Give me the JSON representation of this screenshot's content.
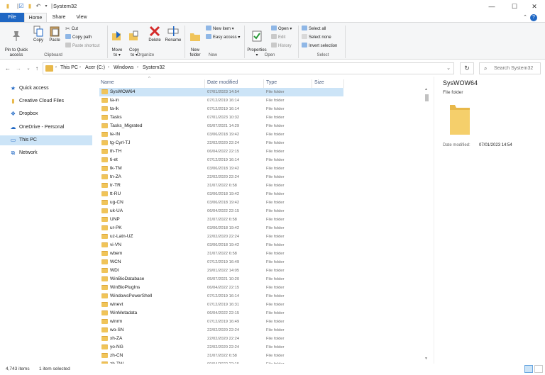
{
  "window": {
    "title": "System32",
    "controls": {
      "minimize": "—",
      "maximize": "☐",
      "close": "✕"
    }
  },
  "ribbon_tabs": [
    "File",
    "Home",
    "Share",
    "View"
  ],
  "ribbon": {
    "clipboard": {
      "label": "Clipboard",
      "pin": "Pin to Quick\naccess",
      "copy": "Copy",
      "paste": "Paste",
      "cut": "Cut",
      "copy_path": "Copy path",
      "paste_shortcut": "Paste shortcut"
    },
    "organize": {
      "label": "Organize",
      "move_to": "Move\nto ▾",
      "copy_to": "Copy\nto ▾",
      "delete": "Delete",
      "rename": "Rename"
    },
    "new": {
      "label": "New",
      "new_folder": "New\nfolder",
      "new_item": "New item ▾",
      "easy_access": "Easy access ▾"
    },
    "open": {
      "label": "Open",
      "properties": "Properties\n▾",
      "open": "Open ▾",
      "edit": "Edit",
      "history": "History"
    },
    "select": {
      "label": "Select",
      "select_all": "Select all",
      "select_none": "Select none",
      "invert": "Invert selection"
    }
  },
  "address": {
    "crumbs": [
      "This PC",
      "Acer (C:)",
      "Windows",
      "System32"
    ]
  },
  "search": {
    "placeholder": "Search System32"
  },
  "nav_pane": [
    {
      "label": "Quick access",
      "icon": "star-icon",
      "color": "#1f67c4"
    },
    {
      "label": "Creative Cloud Files",
      "icon": "creative-cloud-icon",
      "color": "#e8b84a"
    },
    {
      "label": "Dropbox",
      "icon": "dropbox-icon",
      "color": "#1f67c4"
    },
    {
      "label": "OneDrive - Personal",
      "icon": "onedrive-icon",
      "color": "#1f67c4"
    },
    {
      "label": "This PC",
      "icon": "computer-icon",
      "color": "#1f67c4",
      "selected": true
    },
    {
      "label": "Network",
      "icon": "network-icon",
      "color": "#1f67c4"
    }
  ],
  "columns": {
    "name": "Name",
    "date": "Date modified",
    "type": "Type",
    "size": "Size"
  },
  "files": [
    {
      "name": "SysWOW64",
      "date": "07/01/2023 14:54",
      "type": "File folder",
      "selected": true
    },
    {
      "name": "ta-in",
      "date": "07/12/2019 16:14",
      "type": "File folder"
    },
    {
      "name": "ta-lk",
      "date": "07/12/2019 16:14",
      "type": "File folder"
    },
    {
      "name": "Tasks",
      "date": "07/01/2023 10:32",
      "type": "File folder"
    },
    {
      "name": "Tasks_Migrated",
      "date": "05/07/2021 14:29",
      "type": "File folder"
    },
    {
      "name": "te-IN",
      "date": "03/06/2018 19:42",
      "type": "File folder"
    },
    {
      "name": "tg-Cyrl-TJ",
      "date": "22/02/2020 22:24",
      "type": "File folder"
    },
    {
      "name": "th-TH",
      "date": "06/04/2022 22:15",
      "type": "File folder"
    },
    {
      "name": "ti-et",
      "date": "07/12/2019 16:14",
      "type": "File folder"
    },
    {
      "name": "tk-TM",
      "date": "03/06/2018 19:42",
      "type": "File folder"
    },
    {
      "name": "tn-ZA",
      "date": "22/02/2020 22:24",
      "type": "File folder"
    },
    {
      "name": "tr-TR",
      "date": "31/07/2022 6:58",
      "type": "File folder"
    },
    {
      "name": "tt-RU",
      "date": "03/06/2018 19:42",
      "type": "File folder"
    },
    {
      "name": "ug-CN",
      "date": "03/06/2018 19:42",
      "type": "File folder"
    },
    {
      "name": "uk-UA",
      "date": "06/04/2022 22:15",
      "type": "File folder"
    },
    {
      "name": "UNP",
      "date": "31/07/2022 6:58",
      "type": "File folder"
    },
    {
      "name": "ur-PK",
      "date": "03/06/2018 19:42",
      "type": "File folder"
    },
    {
      "name": "uz-Latn-UZ",
      "date": "22/02/2020 22:24",
      "type": "File folder"
    },
    {
      "name": "vi-VN",
      "date": "03/06/2018 19:42",
      "type": "File folder"
    },
    {
      "name": "wbem",
      "date": "31/07/2022 6:58",
      "type": "File folder"
    },
    {
      "name": "WCN",
      "date": "07/12/2019 16:49",
      "type": "File folder"
    },
    {
      "name": "WDI",
      "date": "29/01/2022 14:05",
      "type": "File folder"
    },
    {
      "name": "WinBioDatabase",
      "date": "05/07/2021 10:20",
      "type": "File folder"
    },
    {
      "name": "WinBioPlugIns",
      "date": "06/04/2022 22:15",
      "type": "File folder"
    },
    {
      "name": "WindowsPowerShell",
      "date": "07/12/2019 16:14",
      "type": "File folder"
    },
    {
      "name": "winevt",
      "date": "07/12/2019 16:31",
      "type": "File folder"
    },
    {
      "name": "WinMetadata",
      "date": "06/04/2022 22:15",
      "type": "File folder"
    },
    {
      "name": "winrm",
      "date": "07/12/2019 16:49",
      "type": "File folder"
    },
    {
      "name": "wo-SN",
      "date": "22/02/2020 22:24",
      "type": "File folder"
    },
    {
      "name": "xh-ZA",
      "date": "22/02/2020 22:24",
      "type": "File folder"
    },
    {
      "name": "yo-NG",
      "date": "22/02/2020 22:24",
      "type": "File folder"
    },
    {
      "name": "zh-CN",
      "date": "31/07/2022 6:58",
      "type": "File folder"
    },
    {
      "name": "zh-TW",
      "date": "09/04/2022 22:15",
      "type": "File folder"
    }
  ],
  "preview": {
    "title": "SysWOW64",
    "subtitle": "File folder",
    "date_label": "Date modified:",
    "date_value": "07/01/2023 14:54"
  },
  "status": {
    "count": "4,743 items",
    "selected": "1 item selected"
  },
  "colors": {
    "accent": "#1f67c4",
    "selection": "#cce4f7",
    "folder": "#f0c45a",
    "delete": "#d42a2a"
  }
}
